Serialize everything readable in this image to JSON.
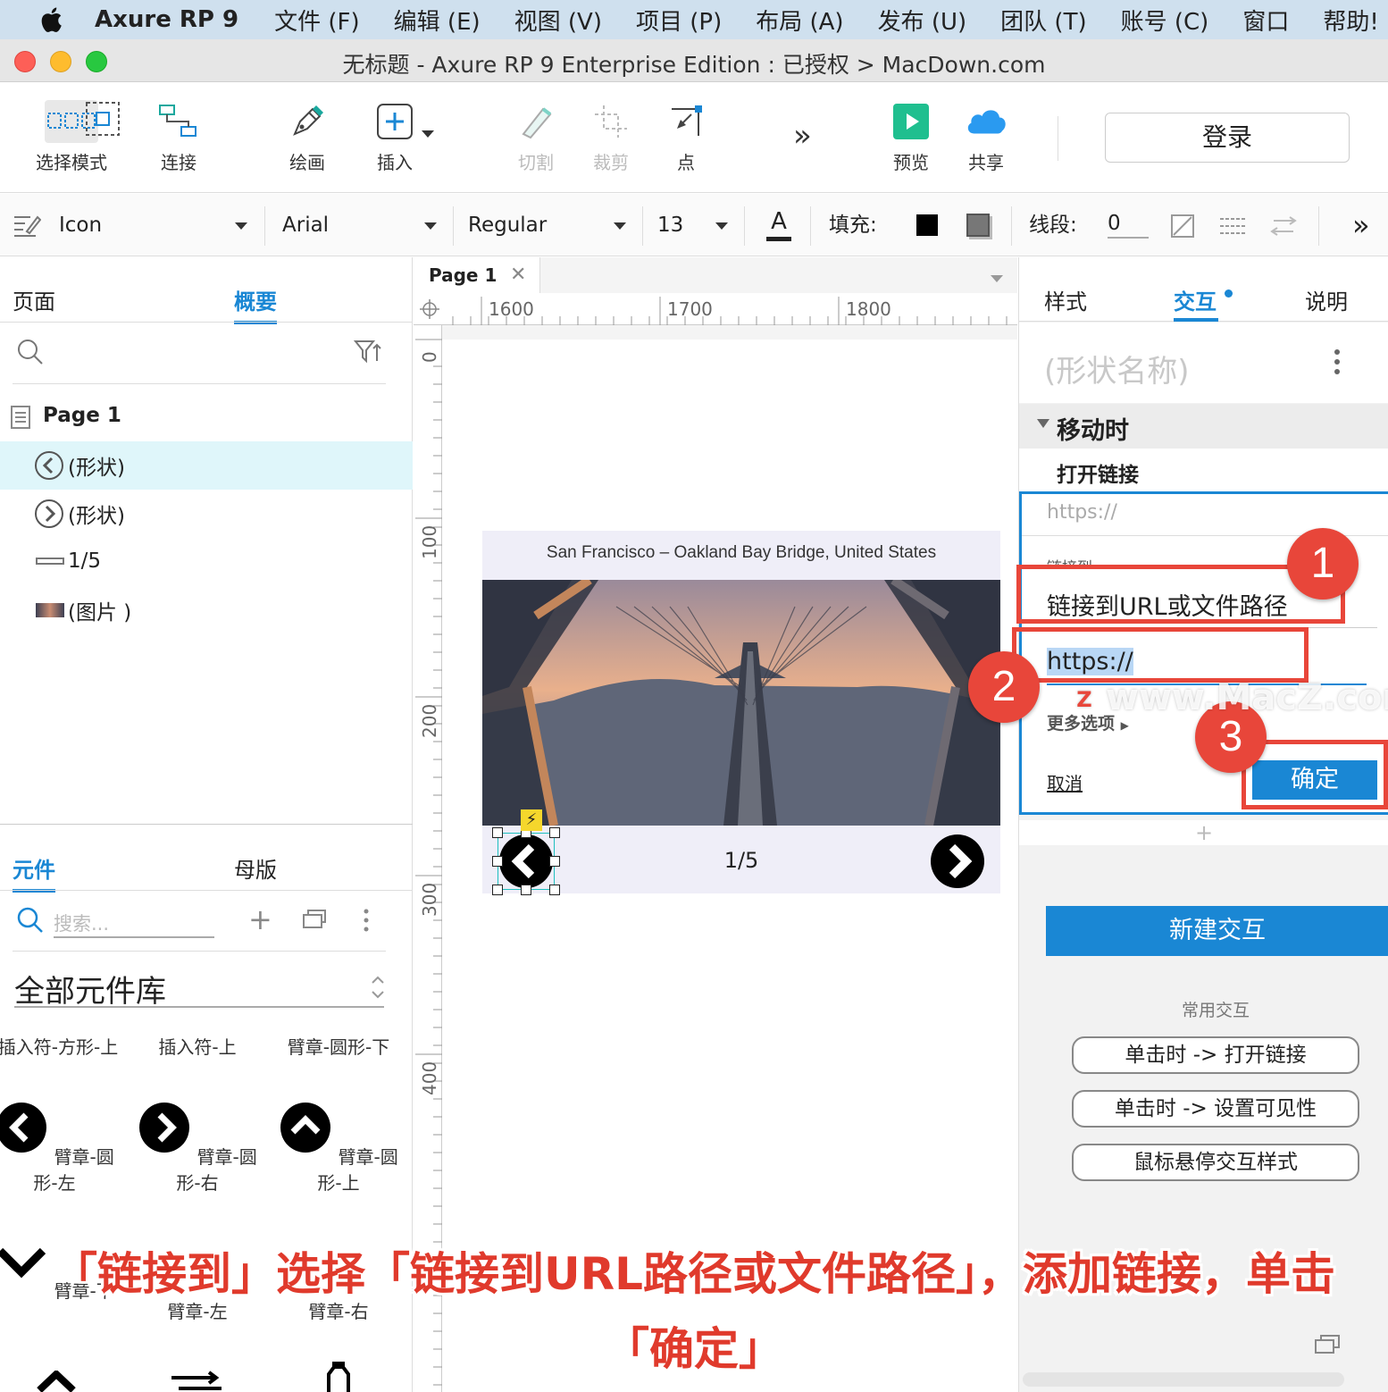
{
  "menubar": {
    "app": "Axure RP 9",
    "items": [
      "文件 (F)",
      "编辑 (E)",
      "视图 (V)",
      "项目 (P)",
      "布局 (A)",
      "发布 (U)",
      "团队 (T)",
      "账号 (C)",
      "窗口",
      "帮助!"
    ]
  },
  "window": {
    "title": "无标题 - Axure RP 9 Enterprise Edition : 已授权 > MacDown.com"
  },
  "toolbar": {
    "select_mode": "选择模式",
    "connect": "连接",
    "draw": "绘画",
    "insert": "插入",
    "slice": "切割",
    "crop": "裁剪",
    "point": "点",
    "more": "»",
    "preview": "预览",
    "share": "共享",
    "login": "登录"
  },
  "format": {
    "style_name": "Icon",
    "font": "Arial",
    "weight": "Regular",
    "size": "13",
    "fill_label": "填充:",
    "stroke_label": "线段:",
    "stroke_value": "0",
    "more": "»"
  },
  "left_panel": {
    "tab_pages": "页面",
    "tab_outline": "概要",
    "page_name": "Page 1",
    "outline": [
      {
        "label": "(形状)",
        "selected": true
      },
      {
        "label": "(形状)",
        "selected": false
      },
      {
        "label": "1/5",
        "selected": false
      },
      {
        "label": "(图片 )",
        "selected": false
      }
    ],
    "tab_widgets": "元件",
    "tab_masters": "母版",
    "search_placeholder": "搜索...",
    "library": "全部元件库",
    "lib_row1": [
      "插入符-方形-上",
      "插入符-上",
      "臂章-圆形-下"
    ],
    "lib_row2": [
      "臂章-圆形-左",
      "臂章-圆形-右",
      "臂章-圆形-上"
    ],
    "lib_row3": [
      "臂章-下",
      "臂章-左",
      "臂章-右"
    ]
  },
  "canvas": {
    "page_tab": "Page 1",
    "ruler_h": [
      "1600",
      "1700",
      "1800"
    ],
    "ruler_v": [
      "0",
      "100",
      "200",
      "300",
      "400"
    ],
    "caption": "San Francisco – Oakland Bay Bridge, United States",
    "counter": "1/5"
  },
  "right_panel": {
    "tab_style": "样式",
    "tab_interact": "交互",
    "tab_notes": "说明",
    "shape_name_placeholder": "(形状名称)",
    "event": "移动时",
    "action": "打开链接",
    "url_display": "https://",
    "link_to_label": "链接到",
    "link_to_value": "链接到URL或文件路径",
    "url_input": "https://",
    "more_options": "更多选项",
    "cancel": "取消",
    "ok": "确定",
    "add": "+",
    "new_interaction": "新建交互",
    "common_label": "常用交互",
    "common": [
      "单击时 -> 打开链接",
      "单击时 -> 设置可见性",
      "鼠标悬停交互样式"
    ]
  },
  "annotations": {
    "steps": [
      "1",
      "2",
      "3"
    ],
    "watermark": "www.MacZ.com",
    "caption_line1": "「链接到」选择「链接到URL路径或文件路径」，添加链接，单击",
    "caption_line2": "「确定」"
  },
  "colors": {
    "accent": "#1a87d4",
    "annotation": "#e8463a",
    "menubar": "#cfe0ee"
  }
}
